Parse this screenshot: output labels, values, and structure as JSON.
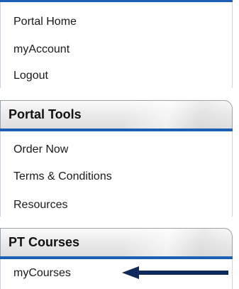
{
  "nav": {
    "main_links": [
      {
        "label": "Portal Home"
      },
      {
        "label": "myAccount"
      },
      {
        "label": "Logout"
      }
    ],
    "portal_tools": {
      "title": "Portal Tools",
      "links": [
        {
          "label": "Order Now"
        },
        {
          "label": "Terms & Conditions"
        },
        {
          "label": "Resources"
        }
      ]
    },
    "pt_courses": {
      "title": "PT Courses",
      "links": [
        {
          "label": "myCourses"
        }
      ]
    }
  },
  "colors": {
    "accent_blue": "#1a5fb4",
    "arrow_navy": "#0e2a5c"
  },
  "annotation": {
    "arrow_icon": "arrow-left-icon"
  }
}
